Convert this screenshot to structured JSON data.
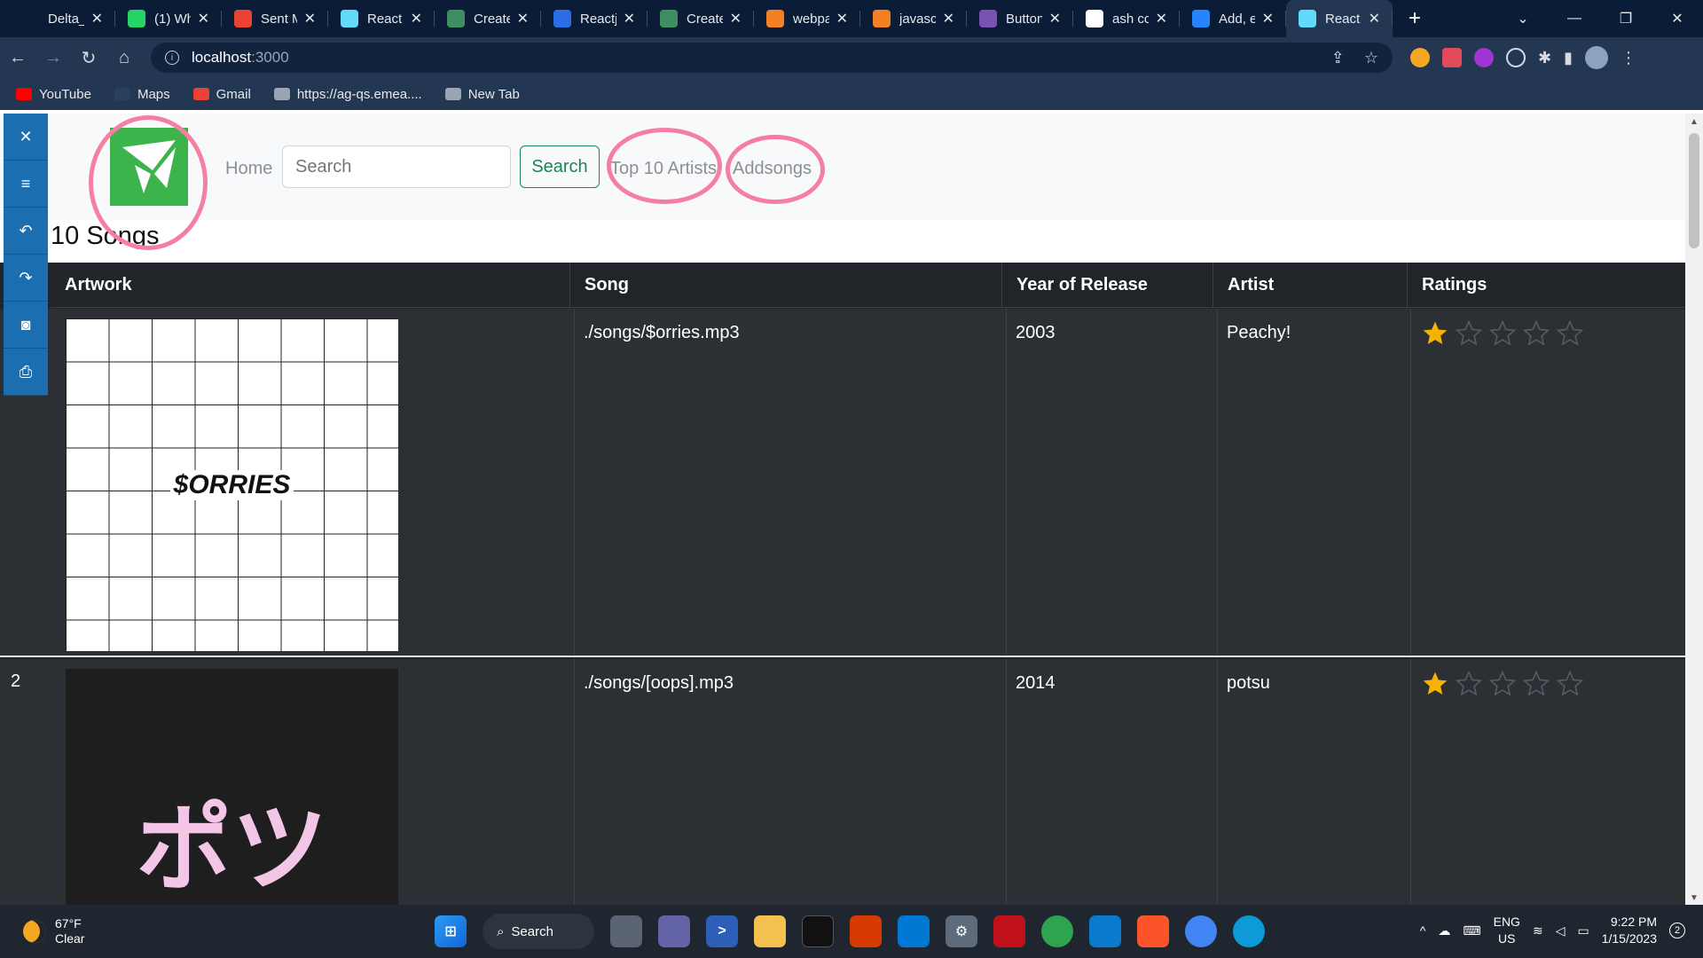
{
  "browser": {
    "tabs": [
      {
        "label": "Delta_",
        "icon": "github-icon",
        "color": "#0b1d36"
      },
      {
        "label": "(1) Wh",
        "icon": "whatsapp-icon",
        "color": "#25d366"
      },
      {
        "label": "Sent M",
        "icon": "gmail-icon",
        "color": "#ea4335"
      },
      {
        "label": "React",
        "icon": "react-icon",
        "color": "#61dafb"
      },
      {
        "label": "Create",
        "icon": "vite-icon",
        "color": "#3d8f62"
      },
      {
        "label": "Reactj",
        "icon": "bolt-icon",
        "color": "#2b6de6"
      },
      {
        "label": "Create",
        "icon": "vite-icon",
        "color": "#3d8f62"
      },
      {
        "label": "webpa",
        "icon": "stackoverflow-icon",
        "color": "#f48024"
      },
      {
        "label": "javasc",
        "icon": "stackoverflow-icon",
        "color": "#f48024"
      },
      {
        "label": "Button",
        "icon": "bootstrap-icon",
        "color": "#7952b3"
      },
      {
        "label": "ash cc",
        "icon": "google-icon",
        "color": "#ffffff"
      },
      {
        "label": "Add, e",
        "icon": "atlassian-icon",
        "color": "#2684ff"
      },
      {
        "label": "React",
        "icon": "react-icon",
        "color": "#61dafb",
        "active": true
      }
    ],
    "new_tab": "+",
    "window_controls": [
      "⌄",
      "—",
      "❐",
      "✕"
    ],
    "url_host": "localhost",
    "url_port": ":3000",
    "bookmarks": [
      {
        "label": "YouTube",
        "color": "#ff0000"
      },
      {
        "label": "Maps",
        "color": "#2b3f5f"
      },
      {
        "label": "Gmail",
        "color": "#ea4335"
      },
      {
        "label": "https://ag-qs.emea....",
        "color": "#9aa5b4"
      },
      {
        "label": "New Tab",
        "color": "#9aa5b4"
      }
    ]
  },
  "sidetools": [
    "✕",
    "≡",
    "↶",
    "↷",
    "◙",
    "⎙"
  ],
  "navbar": {
    "home": "Home",
    "search_placeholder": "Search",
    "search_button": "Search",
    "top_artists": "Top 10 Artists",
    "addsongs": "Addsongs"
  },
  "heading": "10 Songs",
  "table": {
    "headers": [
      "Artwork",
      "Song",
      "Year of Release",
      "Artist",
      "Ratings"
    ],
    "rows": [
      {
        "num": "",
        "art_text": "$ORRIES",
        "song": "./songs/$orries.mp3",
        "year": "2003",
        "artist": "Peachy!",
        "rating": 1
      },
      {
        "num": "2",
        "art_text": "ポツ",
        "song": "./songs/[oops].mp3",
        "year": "2014",
        "artist": "potsu",
        "rating": 1
      }
    ]
  },
  "colors": {
    "star": "#f5b301",
    "annotation": "#f47fa3",
    "logo": "#3cb44b",
    "search_btn": "#198754"
  },
  "taskbar": {
    "temp": "67°F",
    "condition": "Clear",
    "search_label": "Search",
    "lang_top": "ENG",
    "lang_bottom": "US",
    "time": "9:22 PM",
    "date": "1/15/2023",
    "notifications": "2"
  }
}
